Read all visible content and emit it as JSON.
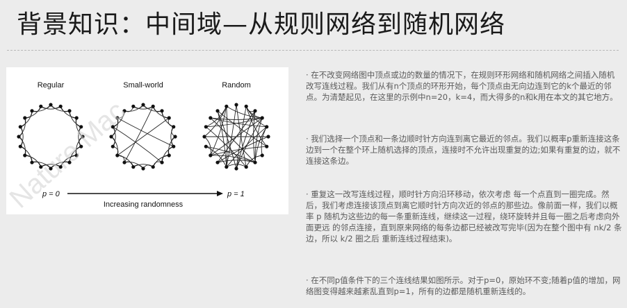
{
  "slide": {
    "title": "背景知识：中间域—从规则网络到随机网络",
    "figure": {
      "labels": [
        "Regular",
        "Small-world",
        "Random"
      ],
      "p_left": "p = 0",
      "p_right": "p = 1",
      "axis_label": "Increasing randomness",
      "watermark": "Nature Mac"
    },
    "paragraphs": [
      "· 在不改变网络图中顶点或边的数量的情况下，在规则环形网络和随机网络之间插入随机改写连线过程。我们从有n个顶点的环形开始，每个顶点由无向边连到它的k个最近的邻点。为清楚起见，在这里的示例中n=20，k=4，而大得多的n和k用在本文的其它地方。",
      "· 我们选择一个顶点和一条边顺时针方向连到离它最近的邻点。我们以概率p重新连接这条边到一个在整个环上随机选择的顶点，连接时不允许出现重复的边;如果有重复的边，就不连接这条边。",
      "· 重复这一改写连线过程，顺时针方向沿环移动，依次考虑 每一个点直到一圈完成。然后，我们考虑连接该顶点到离它顺时针方向次近的邻点的那些边。像前面一样，我们以概率 p 随机为这些边的每一条重新连线，继续这一过程，绕环旋转并且每一圈之后考虑向外面更远 的邻点连接，直到原来网络的每条边都已经被改写完毕(因为在整个图中有 nk/2 条边，所以 k/2 圈之后 重新连线过程结束)。",
      "· 在不同p值条件下的三个连线结果如图所示。对于p=0，原始环不变;随着p值的增加，网络图变得越来越紊乱直到p=1，所有的边都是随机重新连线的。"
    ]
  }
}
